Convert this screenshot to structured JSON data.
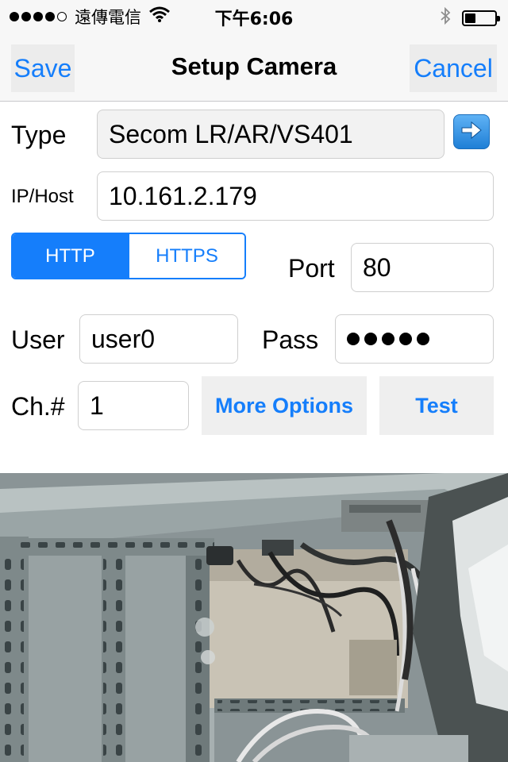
{
  "status_bar": {
    "carrier": "遠傳電信",
    "time": "下午6:06"
  },
  "nav": {
    "save_label": "Save",
    "title": "Setup Camera",
    "cancel_label": "Cancel"
  },
  "form": {
    "type_label": "Type",
    "type_value": "Secom LR/AR/VS401",
    "ip_label": "IP/Host",
    "ip_value": "10.161.2.179",
    "protocol_options": [
      "HTTP",
      "HTTPS"
    ],
    "selected_protocol": "HTTP",
    "port_label": "Port",
    "port_value": "80",
    "user_label": "User",
    "user_value": "user0",
    "pass_label": "Pass",
    "channel_label": "Ch.#",
    "channel_value": "1",
    "more_options_label": "More Options",
    "test_label": "Test"
  },
  "colors": {
    "accent": "#157efb",
    "bar_background": "#f7f7f7"
  },
  "icons": {
    "wifi": "wifi-icon",
    "bluetooth": "bluetooth-icon",
    "battery": "battery-icon",
    "type_arrow": "arrow-right-icon"
  }
}
